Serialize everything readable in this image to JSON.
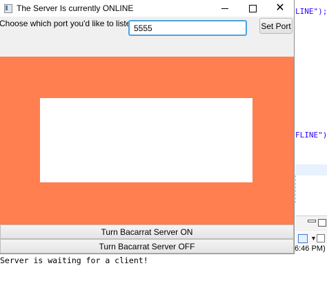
{
  "window": {
    "title": "The Server Is currently ONLINE",
    "controls": {
      "minimize": "minimize",
      "maximize": "maximize",
      "close": "✕"
    }
  },
  "port": {
    "label": "Choose which port you'd like to listen on:",
    "value": "5555",
    "set_button": "Set Port"
  },
  "panel": {
    "background_color": "#ff7f50"
  },
  "buttons": {
    "server_on": "Turn Bacarrat Server ON",
    "server_off": "Turn Bacarrat Server OFF"
  },
  "ide": {
    "code_line_1": "LINE\");",
    "code_line_2": "FLINE\");",
    "time_fragment": "6:46 PM)",
    "console_output": "Server is waiting for a client!"
  }
}
